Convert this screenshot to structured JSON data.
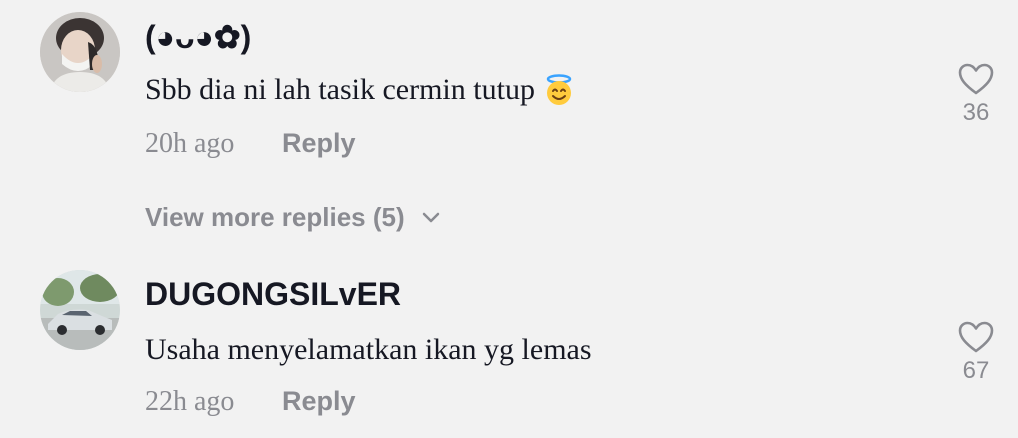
{
  "comments": [
    {
      "username": "(◕ᴗ◕✿)",
      "text": "Sbb dia ni lah tasik cermin tutup",
      "emoji": "😇",
      "time": "20h ago",
      "reply_label": "Reply",
      "like_count": "36",
      "view_more_label": "View more replies (5)",
      "avatar_icon": "person-in-mask-avatar"
    },
    {
      "username": "DUGONGSILvER",
      "text": "Usaha menyelamatkan ikan yg lemas",
      "time": "22h ago",
      "reply_label": "Reply",
      "like_count": "67",
      "avatar_icon": "silver-car-avatar"
    }
  ],
  "colors": {
    "background": "#f2f2f2",
    "primary_text": "#161823",
    "secondary_text": "#8a8b91"
  }
}
